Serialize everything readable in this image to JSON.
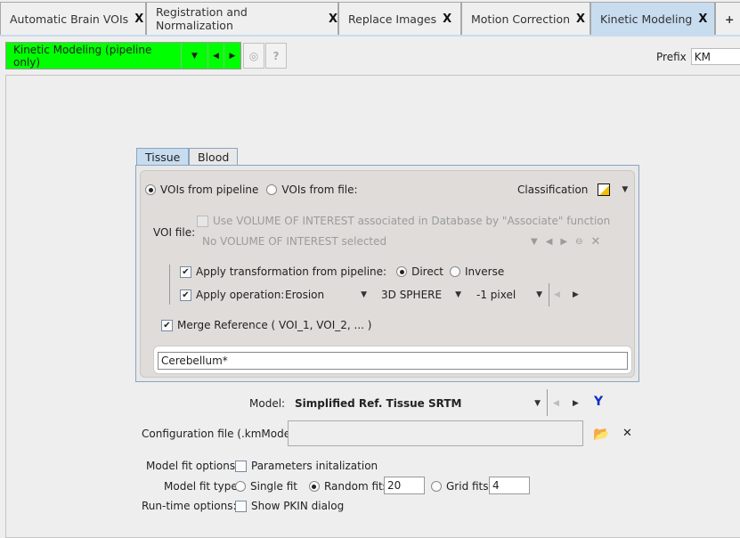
{
  "tabs": [
    {
      "label": "Automatic Brain VOIs",
      "selected": false
    },
    {
      "label": "Registration and Normalization",
      "selected": false
    },
    {
      "label": "Replace Images",
      "selected": false
    },
    {
      "label": "Motion Correction",
      "selected": false
    },
    {
      "label": "Kinetic Modeling",
      "selected": true
    }
  ],
  "tab_close": "X",
  "tab_add": "+",
  "toolbar": {
    "pipeline": "Kinetic Modeling (pipeline only)",
    "help": "?",
    "prefix_label": "Prefix",
    "prefix_value": "KM",
    "accent": "#00ff00"
  },
  "panel_tabs": {
    "tissue": "Tissue",
    "blood": "Blood"
  },
  "voi": {
    "from_pipeline": "VOIs from pipeline",
    "from_file": "VOIs from file:",
    "source_selected": "pipeline",
    "classification": "Classification",
    "voi_file_label": "VOI file:",
    "use_db": "Use VOLUME OF INTEREST associated in Database by \"Associate\" function",
    "no_voi": "No VOLUME OF INTEREST selected",
    "apply_transform": "Apply transformation from pipeline:",
    "apply_transform_checked": true,
    "direct": "Direct",
    "inverse": "Inverse",
    "direction_selected": "Direct",
    "apply_operation": "Apply operation:",
    "apply_operation_checked": true,
    "operation": "Erosion",
    "shape": "3D SPHERE",
    "size": "-1 pixel",
    "merge": "Merge Reference ( VOI_1, VOI_2, ... )",
    "merge_checked": true,
    "reference": "Cerebellum*"
  },
  "model": {
    "label": "Model:",
    "value": "Simplified Ref. Tissue SRTM",
    "config_label": "Configuration file (.kmModel)",
    "config_value": "",
    "fit_options_label": "Model fit options:",
    "param_init": "Parameters initalization",
    "param_init_checked": false,
    "fit_type_label": "Model fit type:",
    "single": "Single fit",
    "random": "Random fits",
    "random_value": "20",
    "grid": "Grid fits",
    "grid_value": "4",
    "fit_type_selected": "Random fits",
    "runtime_label": "Run-time options:",
    "show_pkin": "Show PKIN dialog",
    "show_pkin_checked": false
  }
}
